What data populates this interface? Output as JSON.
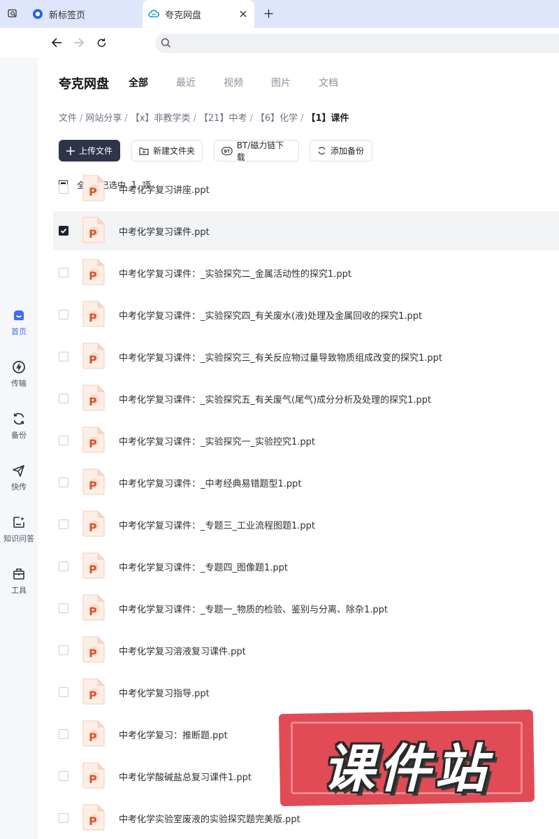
{
  "browser": {
    "tabs": [
      {
        "label": "新标签页",
        "active": false
      },
      {
        "label": "夸克网盘",
        "active": true
      }
    ]
  },
  "sidebar": {
    "items": [
      {
        "label": "首页",
        "icon": "home-face-icon",
        "active": true
      },
      {
        "label": "传输",
        "icon": "transfer-icon",
        "active": false
      },
      {
        "label": "备份",
        "icon": "backup-sync-icon",
        "active": false
      },
      {
        "label": "快传",
        "icon": "paper-plane-icon",
        "active": false
      },
      {
        "label": "知识问答",
        "icon": "knowledge-qa-icon",
        "active": false
      },
      {
        "label": "工具",
        "icon": "toolbox-icon",
        "active": false
      }
    ]
  },
  "header": {
    "brand": "夸克网盘",
    "filter_tabs": [
      {
        "label": "全部",
        "active": true
      },
      {
        "label": "最近",
        "active": false
      },
      {
        "label": "视频",
        "active": false
      },
      {
        "label": "图片",
        "active": false
      },
      {
        "label": "文档",
        "active": false
      }
    ]
  },
  "breadcrumb": [
    "文件",
    "网站分享",
    "【x】非教学类",
    "【21】中考",
    "【6】化学",
    "【1】课件"
  ],
  "breadcrumb_sep": "/",
  "toolbar": {
    "upload": "上传文件",
    "new_folder": "新建文件夹",
    "bt_download": "BT/磁力链下载",
    "add_backup": "添加备份"
  },
  "selection": {
    "select_all": "全选",
    "selected_prefix": "已选中",
    "count": "1",
    "unit": "项"
  },
  "files": [
    {
      "name": "中考化学复习讲座.ppt",
      "selected": false
    },
    {
      "name": "中考化学复习课件.ppt",
      "selected": true
    },
    {
      "name": "中考化学复习课件：_实验探究二_金属活动性的探究1.ppt",
      "selected": false
    },
    {
      "name": "中考化学复习课件：_实验探究四_有关废水(液)处理及金属回收的探究1.ppt",
      "selected": false
    },
    {
      "name": "中考化学复习课件：_实验探究三_有关反应物过量导致物质组成改变的探究1.ppt",
      "selected": false
    },
    {
      "name": "中考化学复习课件：_实验探究五_有关废气(尾气)成分分析及处理的探究1.ppt",
      "selected": false
    },
    {
      "name": "中考化学复习课件：_实验探究一_实验控究1.ppt",
      "selected": false
    },
    {
      "name": "中考化学复习课件：_中考经典易错题型1.ppt",
      "selected": false
    },
    {
      "name": "中考化学复习课件：_专题三_工业流程图题1.ppt",
      "selected": false
    },
    {
      "name": "中考化学复习课件：_专题四_图像题1.ppt",
      "selected": false
    },
    {
      "name": "中考化学复习课件：_专题一_物质的检验、鉴别与分离、除杂1.ppt",
      "selected": false
    },
    {
      "name": "中考化学复习溶液复习课件.ppt",
      "selected": false
    },
    {
      "name": "中考化学复习指导.ppt",
      "selected": false
    },
    {
      "name": "中考化学复习：推断题.ppt",
      "selected": false
    },
    {
      "name": "中考化学酸碱盐总复习课件1.ppt",
      "selected": false
    },
    {
      "name": "中考化学实验室废液的实验探究题完美版.ppt",
      "selected": false
    }
  ],
  "file_icon_letter": "P",
  "watermark": "课件站",
  "colors": {
    "accent": "#3b6ef6",
    "primary_button": "#30344a",
    "ppt_orange": "#d9572b",
    "watermark_red": "#e04b55"
  }
}
